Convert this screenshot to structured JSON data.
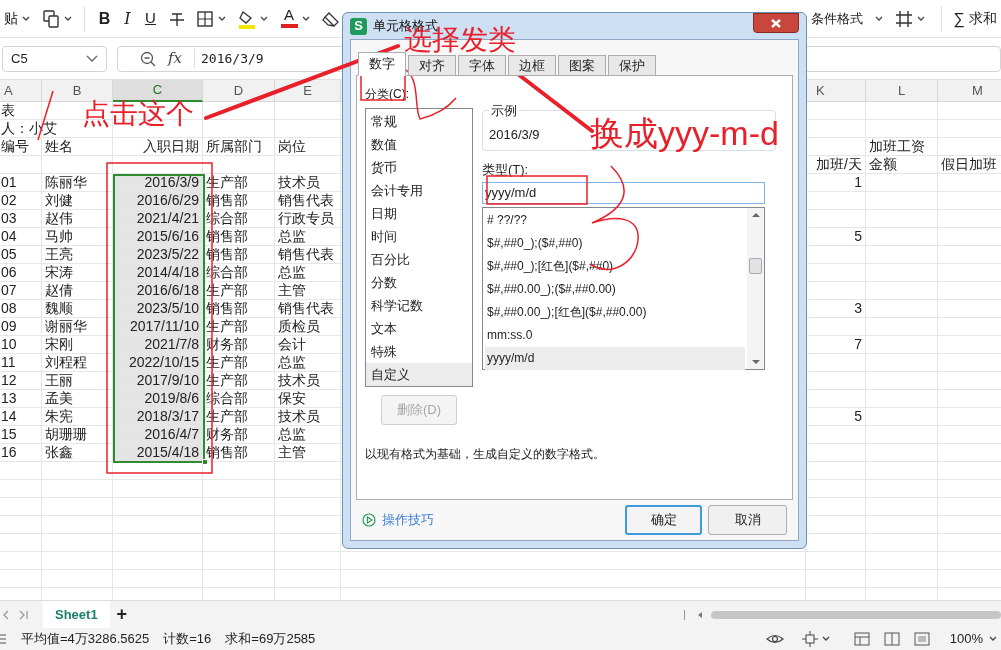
{
  "toolbar": {
    "paste_label": "贴",
    "bold": "B",
    "italic": "I",
    "underline": "U",
    "font_color_glyph": "A",
    "conditional_format": "条件格式",
    "sum_glyph": "∑",
    "sum": "求和"
  },
  "formula_bar": {
    "name_box": "C5",
    "fx": "fx",
    "formula": "2016/3/9"
  },
  "sheet": {
    "columns": [
      {
        "label": "A",
        "selected": false
      },
      {
        "label": "B",
        "selected": false
      },
      {
        "label": "C",
        "selected": true
      },
      {
        "label": "D",
        "selected": false
      },
      {
        "label": "E",
        "selected": false
      },
      {
        "label": "K",
        "selected": false
      },
      {
        "label": "L",
        "selected": false
      },
      {
        "label": "M",
        "selected": false
      }
    ],
    "rows": [
      {
        "selected": false,
        "cells": {
          "A": "表"
        }
      },
      {
        "selected": false,
        "cells": {
          "A": "人：小艾"
        }
      },
      {
        "selected": false,
        "cells": {
          "A": "编号",
          "B": "姓名",
          "C": "入职日期",
          "D": "所属部门",
          "E": "岗位",
          "L": "加班工资"
        }
      },
      {
        "selected": false,
        "cells": {
          "K": "加班/天",
          "L": "金额",
          "M": "假日加班"
        }
      },
      {
        "selected": true,
        "cells": {
          "A": "01",
          "B": "陈丽华",
          "C": "2016/3/9",
          "D": "生产部",
          "E": "技术员",
          "K": "1"
        }
      },
      {
        "selected": true,
        "cells": {
          "A": "02",
          "B": "刘健",
          "C": "2016/6/29",
          "D": "销售部",
          "E": "销售代表"
        }
      },
      {
        "selected": true,
        "cells": {
          "A": "03",
          "B": "赵伟",
          "C": "2021/4/21",
          "D": "综合部",
          "E": "行政专员"
        }
      },
      {
        "selected": true,
        "cells": {
          "A": "04",
          "B": "马帅",
          "C": "2015/6/16",
          "D": "销售部",
          "E": "总监",
          "K": "5"
        }
      },
      {
        "selected": true,
        "cells": {
          "A": "05",
          "B": "王亮",
          "C": "2023/5/22",
          "D": "销售部",
          "E": "销售代表"
        }
      },
      {
        "selected": true,
        "cells": {
          "A": "06",
          "B": "宋涛",
          "C": "2014/4/18",
          "D": "综合部",
          "E": "总监"
        }
      },
      {
        "selected": true,
        "cells": {
          "A": "07",
          "B": "赵倩",
          "C": "2016/6/18",
          "D": "生产部",
          "E": "主管"
        }
      },
      {
        "selected": true,
        "cells": {
          "A": "08",
          "B": "魏顺",
          "C": "2023/5/10",
          "D": "销售部",
          "E": "销售代表",
          "K": "3"
        }
      },
      {
        "selected": true,
        "cells": {
          "A": "09",
          "B": "谢丽华",
          "C": "2017/11/10",
          "D": "生产部",
          "E": "质检员"
        }
      },
      {
        "selected": true,
        "cells": {
          "A": "10",
          "B": "宋刚",
          "C": "2021/7/8",
          "D": "财务部",
          "E": "会计",
          "K": "7"
        }
      },
      {
        "selected": true,
        "cells": {
          "A": "11",
          "B": "刘程程",
          "C": "2022/10/15",
          "D": "生产部",
          "E": "总监"
        }
      },
      {
        "selected": true,
        "cells": {
          "A": "12",
          "B": "王丽",
          "C": "2017/9/10",
          "D": "生产部",
          "E": "技术员"
        }
      },
      {
        "selected": true,
        "cells": {
          "A": "13",
          "B": "孟美",
          "C": "2019/8/6",
          "D": "综合部",
          "E": "保安"
        }
      },
      {
        "selected": true,
        "cells": {
          "A": "14",
          "B": "朱宪",
          "C": "2018/3/17",
          "D": "生产部",
          "E": "技术员",
          "K": "5"
        }
      },
      {
        "selected": true,
        "cells": {
          "A": "15",
          "B": "胡珊珊",
          "C": "2016/4/7",
          "D": "财务部",
          "E": "总监"
        }
      },
      {
        "selected": true,
        "cells": {
          "A": "16",
          "B": "张鑫",
          "C": "2015/4/18",
          "D": "销售部",
          "E": "主管"
        }
      }
    ]
  },
  "dialog": {
    "app_icon": "S",
    "title": "单元格格式",
    "tabs": [
      {
        "label": "数字",
        "selected": true
      },
      {
        "label": "对齐",
        "selected": false
      },
      {
        "label": "字体",
        "selected": false
      },
      {
        "label": "边框",
        "selected": false
      },
      {
        "label": "图案",
        "selected": false
      },
      {
        "label": "保护",
        "selected": false
      }
    ],
    "category_label": "分类(C):",
    "categories": [
      {
        "label": "常规",
        "selected": false
      },
      {
        "label": "数值",
        "selected": false
      },
      {
        "label": "货币",
        "selected": false
      },
      {
        "label": "会计专用",
        "selected": false
      },
      {
        "label": "日期",
        "selected": false
      },
      {
        "label": "时间",
        "selected": false
      },
      {
        "label": "百分比",
        "selected": false
      },
      {
        "label": "分数",
        "selected": false
      },
      {
        "label": "科学记数",
        "selected": false
      },
      {
        "label": "文本",
        "selected": false
      },
      {
        "label": "特殊",
        "selected": false
      },
      {
        "label": "自定义",
        "selected": true
      }
    ],
    "sample_label": "示例",
    "sample": "2016/3/9",
    "type_label": "类型(T):",
    "type_value": "yyyy/m/d",
    "formats": [
      {
        "label": "# ??/??",
        "selected": false
      },
      {
        "label": "$#,##0_);($#,##0)",
        "selected": false
      },
      {
        "label": "$#,##0_);[红色]($#,##0)",
        "selected": false
      },
      {
        "label": "$#,##0.00_);($#,##0.00)",
        "selected": false
      },
      {
        "label": "$#,##0.00_);[红色]($#,##0.00)",
        "selected": false
      },
      {
        "label": "mm:ss.0",
        "selected": false
      },
      {
        "label": "yyyy/m/d",
        "selected": true
      }
    ],
    "delete_button": {
      "label": "删除(D)",
      "disabled": true
    },
    "description": "以现有格式为基础，生成自定义的数字格式。",
    "tips_link": "操作技巧",
    "ok_button": "确定",
    "cancel_button": "取消"
  },
  "annotations": [
    {
      "text": "点击这个"
    },
    {
      "text": "选择发类"
    },
    {
      "text": "换成yyy-m-d"
    }
  ],
  "sheet_tabs": [
    {
      "label": "Sheet1",
      "selected": true
    }
  ],
  "add_sheet": "+",
  "status_bar": {
    "items": [
      "平均值=4万3286.5625",
      "计数=16",
      "求和=69万2585"
    ],
    "zoom": "100%"
  }
}
